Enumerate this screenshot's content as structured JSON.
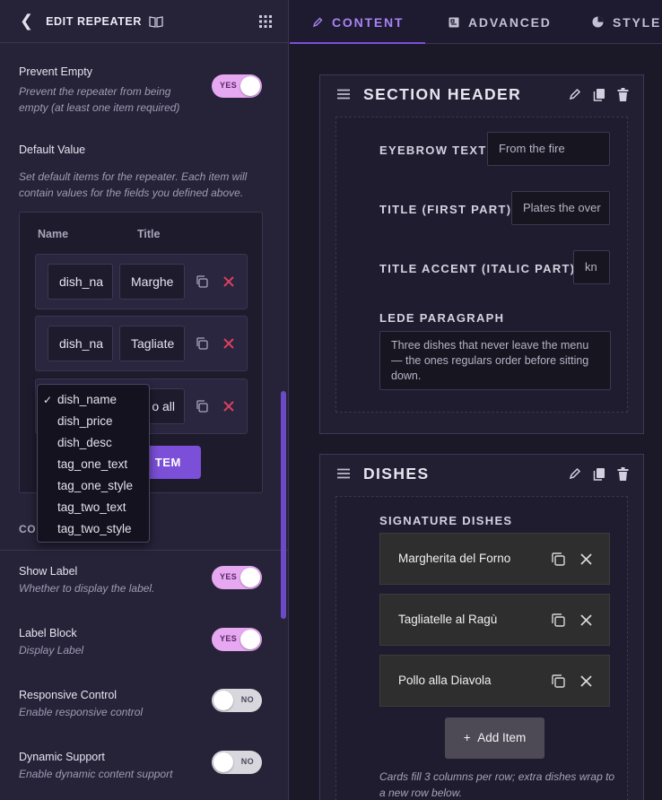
{
  "panel": {
    "title": "EDIT REPEATER",
    "prevent_empty": {
      "label": "Prevent Empty",
      "description": "Prevent the repeater from being empty (at least one item required)",
      "toggle": "YES"
    },
    "default_value": {
      "label": "Default Value",
      "description": "Set default items for the repeater. Each item will contain values for the fields you defined above.",
      "columns": [
        "Name",
        "Title"
      ],
      "rows": [
        {
          "name": "dish_na",
          "title": "Marghe"
        },
        {
          "name": "dish_na",
          "title": "Tagliate"
        },
        {
          "name": "",
          "title": "o all"
        }
      ],
      "add_button": "TEM"
    },
    "dropdown": {
      "selected": "dish_name",
      "options": [
        "dish_name",
        "dish_price",
        "dish_desc",
        "tag_one_text",
        "tag_one_style",
        "tag_two_text",
        "tag_two_style"
      ]
    },
    "section_label_partial": "CO",
    "show_label": {
      "label": "Show Label",
      "description": "Whether to display the label.",
      "toggle": "YES"
    },
    "label_block": {
      "label": "Label Block",
      "description": "Display Label",
      "toggle": "YES"
    },
    "responsive_control": {
      "label": "Responsive Control",
      "description": "Enable responsive control",
      "toggle": "NO"
    },
    "dynamic_support": {
      "label": "Dynamic Support",
      "description": "Enable dynamic content support",
      "toggle": "NO"
    }
  },
  "tabs": [
    {
      "label": "CONTENT",
      "active": true
    },
    {
      "label": "ADVANCED",
      "active": false
    },
    {
      "label": "STYLE",
      "active": false
    }
  ],
  "section_header": {
    "title": "SECTION HEADER",
    "eyebrow_label": "EYEBROW TEXT",
    "eyebrow_value": "From the fire",
    "title_first_label": "TITLE (FIRST PART)",
    "title_first_value": "Plates the over",
    "title_accent_label": "TITLE ACCENT (ITALIC PART)",
    "title_accent_value": "kn",
    "lede_label": "LEDE PARAGRAPH",
    "lede_value": "Three dishes that never leave the menu — the ones regulars order before sitting down."
  },
  "dishes": {
    "title": "DISHES",
    "sub_label": "SIGNATURE DISHES",
    "items": [
      "Margherita del Forno",
      "Tagliatelle al Ragù",
      "Pollo alla Diavola"
    ],
    "add_button": "Add Item",
    "note": "Cards fill 3 columns per row; extra dishes wrap to a new row below."
  },
  "colors": {
    "accent": "#7b4fd8",
    "toggle_on": "#e6a8f1",
    "delete_red": "#e0405a"
  }
}
